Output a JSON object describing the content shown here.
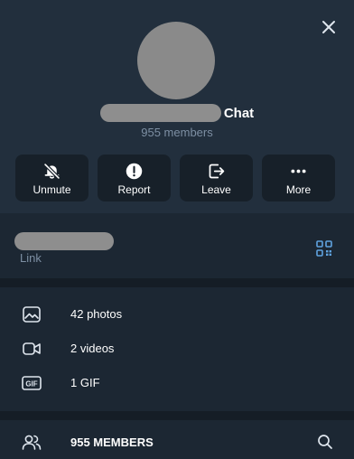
{
  "header": {
    "name_suffix": "Chat",
    "members_subtitle": "955 members"
  },
  "actions": [
    {
      "label": "Unmute",
      "icon": "bell-off-icon"
    },
    {
      "label": "Report",
      "icon": "alert-circle-icon"
    },
    {
      "label": "Leave",
      "icon": "logout-icon"
    },
    {
      "label": "More",
      "icon": "more-dots-icon"
    }
  ],
  "link": {
    "label": "Link",
    "icon": "qr-code-icon"
  },
  "media": [
    {
      "label": "42 photos",
      "icon": "photo-icon"
    },
    {
      "label": "2 videos",
      "icon": "video-icon"
    },
    {
      "label": "1 GIF",
      "icon": "gif-icon"
    }
  ],
  "members": {
    "label": "955 MEMBERS",
    "icon": "users-icon",
    "search_icon": "search-icon"
  },
  "colors": {
    "header_bg": "#222f3d",
    "panel_bg": "#1c2733",
    "button_bg": "#172029",
    "muted_text": "#7d8fa3",
    "accent": "#5fa3e0"
  }
}
